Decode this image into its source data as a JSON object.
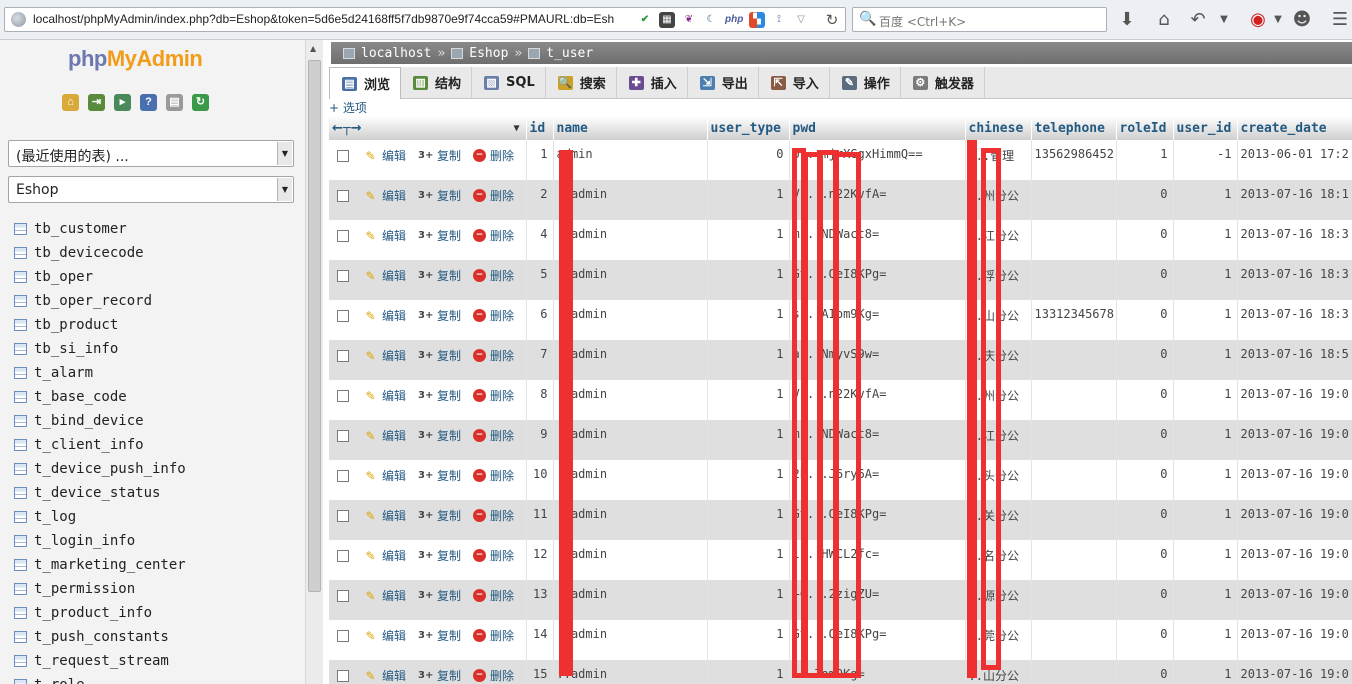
{
  "browser": {
    "url": "localhost/phpMyAdmin/index.php?db=Eshop&token=5d6e5d24168ff5f7db9870e9f74cca59#PMAURL:db=Esh",
    "search_placeholder": "百度 <Ctrl+K>",
    "addon_icons": [
      "shield-icon",
      "qr-icon",
      "feather-icon",
      "moon-icon",
      "php-icon",
      "pma-icon",
      "tool-icon",
      "dropdown-icon"
    ],
    "toolbar_icons": [
      "download-icon",
      "home-icon",
      "back-icon",
      "dropdown-icon",
      "addon-icon",
      "dropdown-icon",
      "chat-icon",
      "menu-icon"
    ]
  },
  "sidebar": {
    "logo_php": "php",
    "logo_admin": "MyAdmin",
    "quick_icons": [
      "home-icon",
      "exit-icon",
      "sql-query-icon",
      "help-icon",
      "docs-icon",
      "reload-icon"
    ],
    "recent_select": "(最近使用的表) ...",
    "db_select": "Eshop",
    "tables": [
      "tb_customer",
      "tb_devicecode",
      "tb_oper",
      "tb_oper_record",
      "tb_product",
      "tb_si_info",
      "t_alarm",
      "t_base_code",
      "t_bind_device",
      "t_client_info",
      "t_device_push_info",
      "t_device_status",
      "t_log",
      "t_login_info",
      "t_marketing_center",
      "t_permission",
      "t_product_info",
      "t_push_constants",
      "t_request_stream",
      "t_role"
    ]
  },
  "breadcrumb": {
    "server": "localhost",
    "database": "Eshop",
    "table": "t_user",
    "separator": "»"
  },
  "tabs": [
    {
      "label": "浏览",
      "icon": "browse-icon",
      "color": "#4a6fa5"
    },
    {
      "label": "结构",
      "icon": "structure-icon",
      "color": "#5a8a3c"
    },
    {
      "label": "SQL",
      "icon": "sql-icon",
      "color": "#6b7fa8"
    },
    {
      "label": "搜索",
      "icon": "search-icon",
      "color": "#c9a227"
    },
    {
      "label": "插入",
      "icon": "insert-icon",
      "color": "#6a4c93"
    },
    {
      "label": "导出",
      "icon": "export-icon",
      "color": "#4a7fb0"
    },
    {
      "label": "导入",
      "icon": "import-icon",
      "color": "#8a5a44"
    },
    {
      "label": "操作",
      "icon": "operations-icon",
      "color": "#5b6b80"
    },
    {
      "label": "触发器",
      "icon": "triggers-icon",
      "color": "#7a7a7a"
    }
  ],
  "options_link": "+ 选项",
  "grid": {
    "columns": [
      "id",
      "name",
      "user_type",
      "pwd",
      "chinese",
      "telephone",
      "roleId",
      "user_id",
      "create_date"
    ],
    "actions": {
      "edit": "编辑",
      "copy": "复制",
      "delete": "删除"
    },
    "rows": [
      {
        "id": "1",
        "name": "admin",
        "user_type": "0",
        "pwd": "U...mjrXGgxHimmQ==",
        "chinese": "...管理",
        "telephone": "13562986452",
        "roleId": "1",
        "user_id": "-1",
        "create_date": "2013-06-01 17:2"
      },
      {
        "id": "2",
        "name": "..admin",
        "user_type": "1",
        "pwd": "VF...n22KvfA=",
        "chinese": "..州分公",
        "telephone": "",
        "roleId": "0",
        "user_id": "1",
        "create_date": "2013-07-16 18:1"
      },
      {
        "id": "4",
        "name": "..admin",
        "user_type": "1",
        "pwd": "m...NDWact8=",
        "chinese": "..江分公",
        "telephone": "",
        "roleId": "0",
        "user_id": "1",
        "create_date": "2013-07-16 18:3"
      },
      {
        "id": "5",
        "name": "..admin",
        "user_type": "1",
        "pwd": "Gt...QeI8KPg=",
        "chinese": "..浮分公",
        "telephone": "",
        "roleId": "0",
        "user_id": "1",
        "create_date": "2013-07-16 18:3"
      },
      {
        "id": "6",
        "name": "..admin",
        "user_type": "1",
        "pwd": "s...AIom9Kg=",
        "chinese": "..山分公",
        "telephone": "13312345678",
        "roleId": "0",
        "user_id": "1",
        "create_date": "2013-07-16 18:3"
      },
      {
        "id": "7",
        "name": "..admin",
        "user_type": "1",
        "pwd": "a...NmyvS9w=",
        "chinese": "..庆分公",
        "telephone": "",
        "roleId": "0",
        "user_id": "1",
        "create_date": "2013-07-16 18:5"
      },
      {
        "id": "8",
        "name": "..admin",
        "user_type": "1",
        "pwd": "VF...n22KvfA=",
        "chinese": "..州分公",
        "telephone": "",
        "roleId": "0",
        "user_id": "1",
        "create_date": "2013-07-16 19:0"
      },
      {
        "id": "9",
        "name": "..admin",
        "user_type": "1",
        "pwd": "m...NDWact8=",
        "chinese": "..江分公",
        "telephone": "",
        "roleId": "0",
        "user_id": "1",
        "create_date": "2013-07-16 19:0"
      },
      {
        "id": "10",
        "name": "..admin",
        "user_type": "1",
        "pwd": "2P...J6ry6A=",
        "chinese": "..头分公",
        "telephone": "",
        "roleId": "0",
        "user_id": "1",
        "create_date": "2013-07-16 19:0"
      },
      {
        "id": "11",
        "name": "..admin",
        "user_type": "1",
        "pwd": "Gt...QeI8KPg=",
        "chinese": "..关分公",
        "telephone": "",
        "roleId": "0",
        "user_id": "1",
        "create_date": "2013-07-16 19:0"
      },
      {
        "id": "12",
        "name": "..admin",
        "user_type": "1",
        "pwd": "l...HWCL2fc=",
        "chinese": "..名分公",
        "telephone": "",
        "roleId": "0",
        "user_id": "1",
        "create_date": "2013-07-16 19:0"
      },
      {
        "id": "13",
        "name": "..admin",
        "user_type": "1",
        "pwd": "+C...2zigZU=",
        "chinese": "..源分公",
        "telephone": "",
        "roleId": "0",
        "user_id": "1",
        "create_date": "2013-07-16 19:0"
      },
      {
        "id": "14",
        "name": "..admin",
        "user_type": "1",
        "pwd": "Gt...QeI8KPg=",
        "chinese": "..莞分公",
        "telephone": "",
        "roleId": "0",
        "user_id": "1",
        "create_date": "2013-07-16 19:0"
      },
      {
        "id": "15",
        "name": "..admin",
        "user_type": "1",
        "pwd": "...Iom9Kg=",
        "chinese": "..山分公",
        "telephone": "",
        "roleId": "0",
        "user_id": "1",
        "create_date": "2013-07-16 19:0"
      }
    ]
  },
  "colors": {
    "link": "#235a81",
    "redaction": "#ee3030",
    "logo_php": "#6c78af",
    "logo_admin": "#f29c1a"
  }
}
